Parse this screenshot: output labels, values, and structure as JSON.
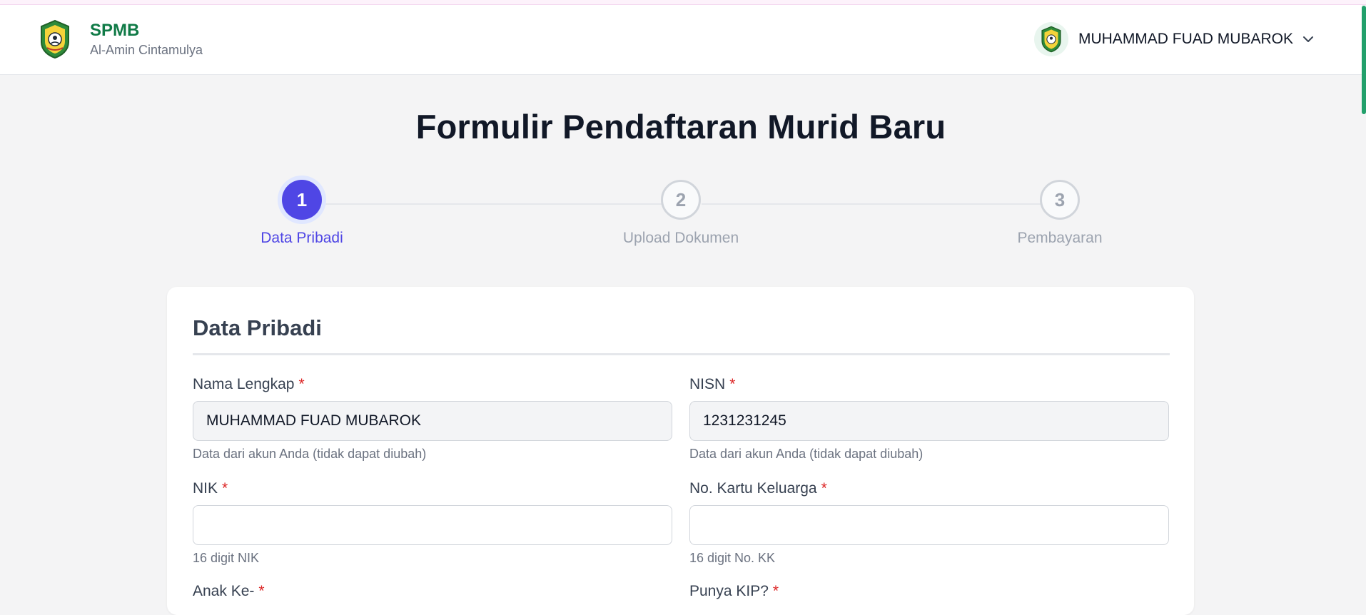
{
  "header": {
    "brand_title": "SPMB",
    "brand_subtitle": "Al-Amin Cintamulya",
    "user_name": "MUHAMMAD FUAD MUBAROK"
  },
  "page_title": "Formulir Pendaftaran Murid Baru",
  "steps": [
    {
      "number": "1",
      "label": "Data Pribadi",
      "state": "active"
    },
    {
      "number": "2",
      "label": "Upload Dokumen",
      "state": "idle"
    },
    {
      "number": "3",
      "label": "Pembayaran",
      "state": "idle"
    }
  ],
  "section": {
    "title": "Data Pribadi",
    "fields": {
      "nama": {
        "label": "Nama Lengkap",
        "required_mark": "*",
        "value": "MUHAMMAD FUAD MUBAROK",
        "hint": "Data dari akun Anda (tidak dapat diubah)"
      },
      "nisn": {
        "label": "NISN",
        "required_mark": "*",
        "value": "1231231245",
        "hint": "Data dari akun Anda (tidak dapat diubah)"
      },
      "nik": {
        "label": "NIK",
        "required_mark": "*",
        "value": "",
        "hint": "16 digit NIK"
      },
      "kk": {
        "label": "No. Kartu Keluarga",
        "required_mark": "*",
        "value": "",
        "hint": "16 digit No. KK"
      },
      "anak_ke": {
        "label": "Anak Ke-",
        "required_mark": "*"
      },
      "kip": {
        "label": "Punya KIP?",
        "required_mark": "*"
      }
    }
  },
  "colors": {
    "brand_green": "#0f7a46",
    "accent_indigo": "#4f46e5",
    "required_red": "#dc2626"
  }
}
